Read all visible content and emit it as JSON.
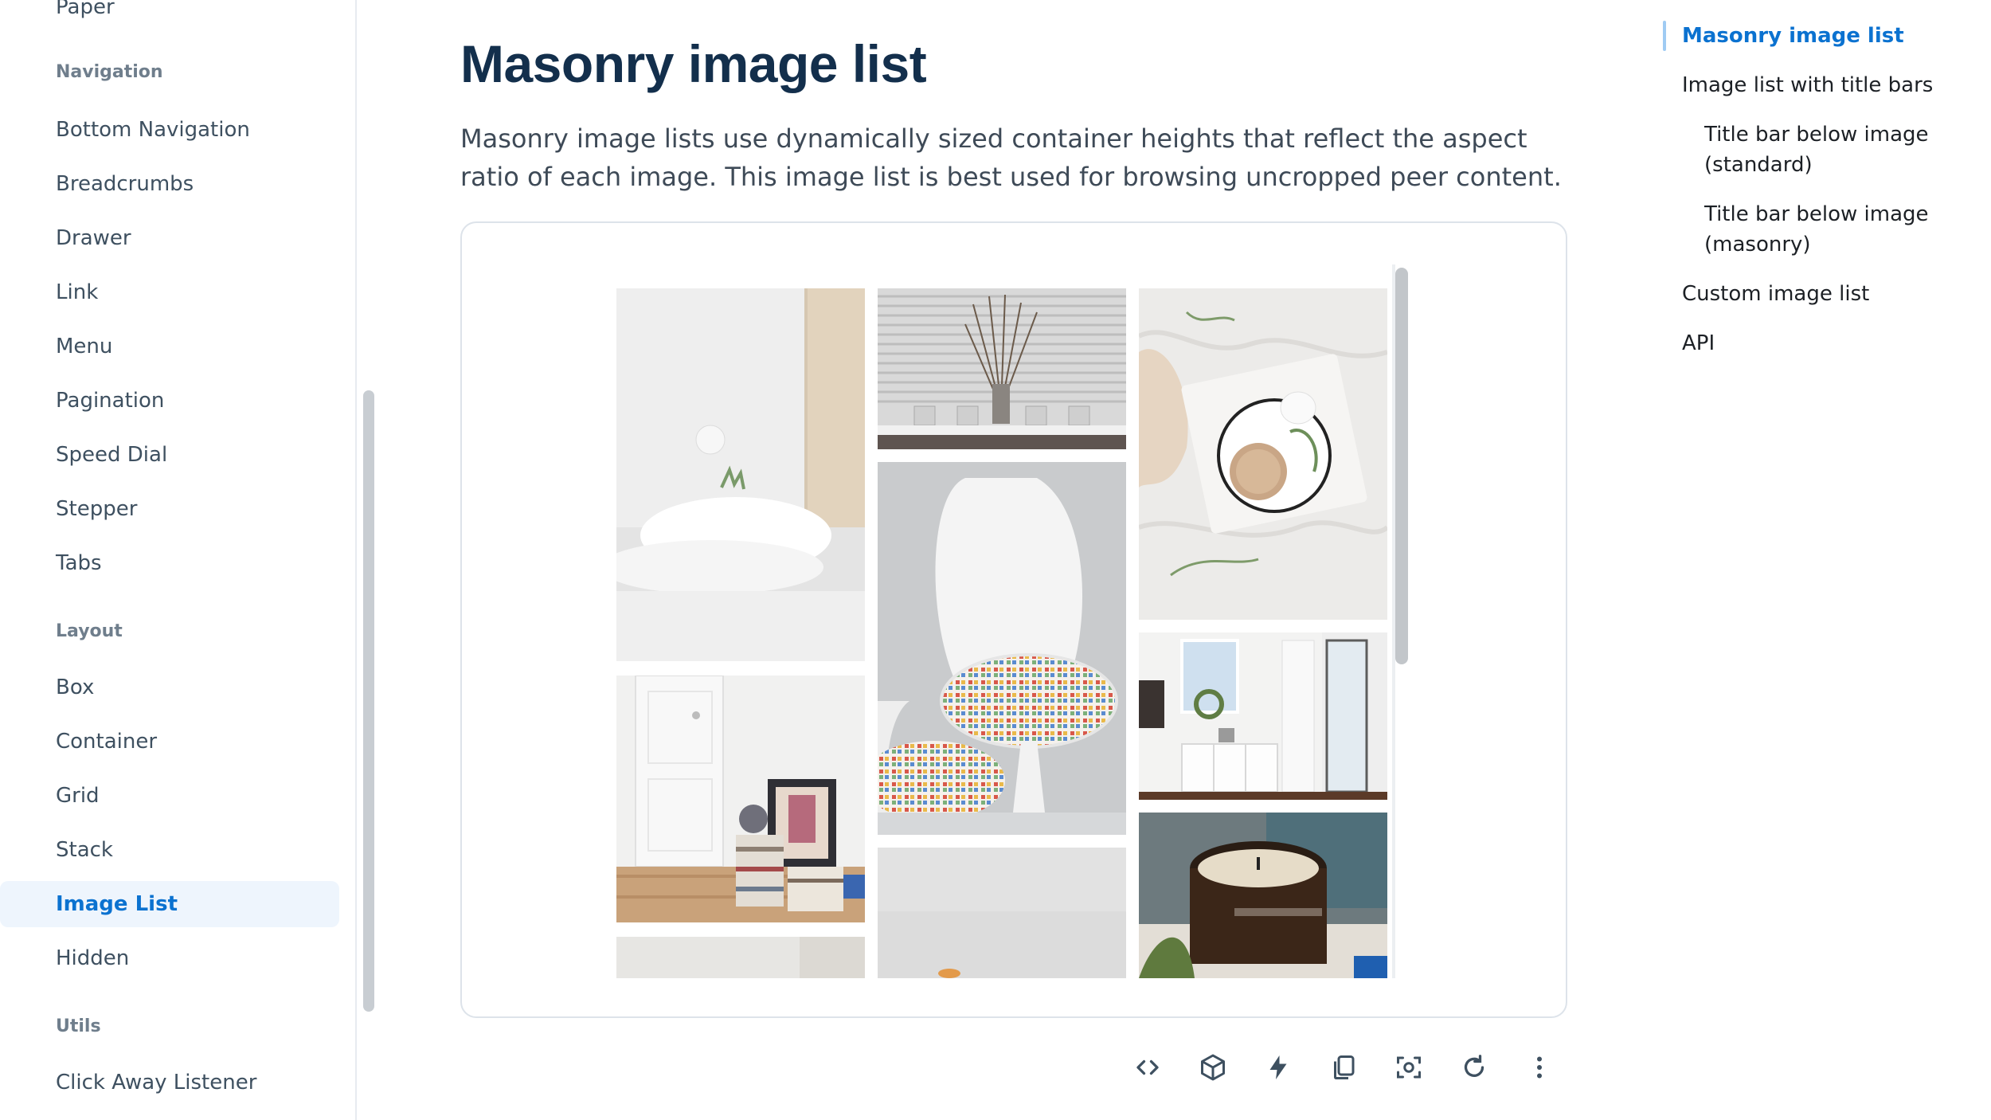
{
  "sidebar": {
    "items": [
      {
        "label": "Paper"
      },
      {
        "label": "Bottom Navigation"
      },
      {
        "label": "Breadcrumbs"
      },
      {
        "label": "Drawer"
      },
      {
        "label": "Link"
      },
      {
        "label": "Menu"
      },
      {
        "label": "Pagination"
      },
      {
        "label": "Speed Dial"
      },
      {
        "label": "Stepper"
      },
      {
        "label": "Tabs"
      },
      {
        "label": "Box"
      },
      {
        "label": "Container"
      },
      {
        "label": "Grid"
      },
      {
        "label": "Stack"
      },
      {
        "label": "Image List"
      },
      {
        "label": "Hidden"
      },
      {
        "label": "Click Away Listener"
      }
    ],
    "headings": [
      "Navigation",
      "Layout",
      "Utils"
    ],
    "active_item": "Image List"
  },
  "main": {
    "title": "Masonry image list",
    "description": "Masonry image lists use dynamically sized container heights that reflect the aspect ratio of each image. This image list is best used for browsing uncropped peer content."
  },
  "image_list": {
    "images": [
      {
        "name": "bed-pillow-image"
      },
      {
        "name": "vase-branches-image"
      },
      {
        "name": "coffee-cup-bed-image"
      },
      {
        "name": "white-chair-image"
      },
      {
        "name": "books-door-image"
      },
      {
        "name": "mudroom-shelf-image"
      },
      {
        "name": "candle-jar-image"
      },
      {
        "name": "grey-wall-image"
      },
      {
        "name": "light-wall-image"
      }
    ]
  },
  "toolbar": {
    "buttons": [
      {
        "icon": "code-icon"
      },
      {
        "icon": "cube-icon"
      },
      {
        "icon": "bolt-icon"
      },
      {
        "icon": "copy-icon"
      },
      {
        "icon": "focus-icon"
      },
      {
        "icon": "refresh-icon"
      },
      {
        "icon": "more-vertical-icon"
      }
    ]
  },
  "toc": {
    "items": [
      {
        "label": "Masonry image list"
      },
      {
        "label": "Image list with title bars"
      },
      {
        "label": "Title bar below image (standard)"
      },
      {
        "label": "Title bar below image (masonry)"
      },
      {
        "label": "Custom image list"
      },
      {
        "label": "API"
      }
    ]
  },
  "colors": {
    "accent": "#0b72d0",
    "active_bg": "#eef5fd",
    "title": "#132f4c"
  }
}
